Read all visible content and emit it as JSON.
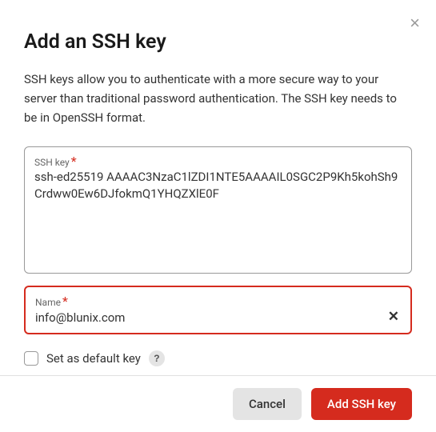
{
  "modal": {
    "title": "Add an SSH key",
    "description": "SSH keys allow you to authenticate with a more secure way to your server than traditional password authentication. The SSH key needs to be in OpenSSH format.",
    "close_glyph": "×"
  },
  "fields": {
    "sshkey": {
      "label": "SSH key",
      "required": "*",
      "value": "ssh-ed25519 AAAAC3NzaC1lZDI1NTE5AAAAIL0SGC2P9Kh5kohSh9Crdww0Ew6DJfokmQ1YHQZXlE0F"
    },
    "name": {
      "label": "Name",
      "required": "*",
      "value": "info@blunix.com",
      "clear_glyph": "✕"
    },
    "default_key": {
      "label": "Set as default key",
      "help_glyph": "?"
    }
  },
  "footer": {
    "cancel": "Cancel",
    "submit": "Add SSH key"
  }
}
